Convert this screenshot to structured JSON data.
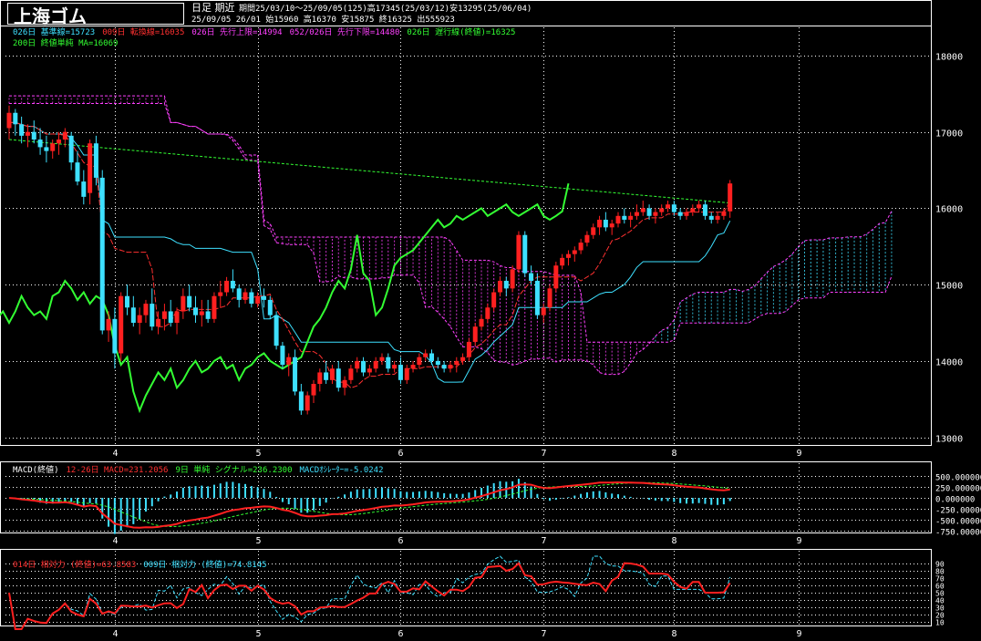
{
  "header": {
    "title": "上海ゴム",
    "period_label": "日足 期近",
    "period_info": "期間25/03/10〜25/09/05(125)高17345(25/03/12)安13295(25/06/04)",
    "last_bar": "25/09/05 26/01 始15960 高16370 安15875 終16325 出555923"
  },
  "legend_main": [
    {
      "text": "026日 基準線=15723",
      "color": "#3ee0ff"
    },
    {
      "text": "009日 転換線=16035",
      "color": "#ff3030"
    },
    {
      "text": "026日 先行上限=14994",
      "color": "#ff40ff"
    },
    {
      "text": "052/026日 先行下限=14480",
      "color": "#ff40ff"
    },
    {
      "text": "026日 遅行線(終値)=16325",
      "color": "#33ff33"
    }
  ],
  "legend_main2": [
    {
      "text": "200日 終値単純 MA=16069",
      "color": "#33ff33"
    }
  ],
  "legend_macd": [
    {
      "text": "MACD(終値)",
      "color": "#ffffff"
    },
    {
      "text": "12-26日 MACD=231.2056",
      "color": "#ff3030"
    },
    {
      "text": "9日 単純 シグナル=236.2300",
      "color": "#33ff33"
    },
    {
      "text": "MACDｵｼﾚｰﾀｰ=-5.0242",
      "color": "#3ee0ff"
    }
  ],
  "legend_rsi": [
    {
      "text": "014日 相対力 (終値)=63.8583",
      "color": "#ff3030"
    },
    {
      "text": "009日 相対力 (終値)=74.8145",
      "color": "#3ee0ff"
    }
  ],
  "chart_data": [
    {
      "type": "candlestick",
      "title": "上海ゴム",
      "x_tick_labels": [
        "4",
        "5",
        "6",
        "7",
        "8",
        "9"
      ],
      "y_ticks": [
        13000,
        14000,
        15000,
        16000,
        17000,
        18000
      ],
      "ylim": [
        12900,
        18250
      ],
      "grid": true,
      "ohlc": [
        [
          17050,
          17345,
          16900,
          17250
        ],
        [
          17250,
          17300,
          16950,
          17100
        ],
        [
          17100,
          17200,
          16850,
          16950
        ],
        [
          16950,
          17100,
          16800,
          17000
        ],
        [
          17000,
          17150,
          16850,
          16900
        ],
        [
          16900,
          17050,
          16700,
          16800
        ],
        [
          16800,
          16950,
          16600,
          16750
        ],
        [
          16750,
          16900,
          16650,
          16850
        ],
        [
          16850,
          17000,
          16700,
          16900
        ],
        [
          16900,
          17050,
          16800,
          17000
        ],
        [
          16950,
          17000,
          16500,
          16600
        ],
        [
          16600,
          16750,
          16300,
          16350
        ],
        [
          16350,
          16500,
          16050,
          16150
        ],
        [
          16200,
          16900,
          16050,
          16850
        ],
        [
          16850,
          16950,
          16300,
          16400
        ],
        [
          16400,
          16500,
          14350,
          14400
        ],
        [
          14400,
          14650,
          14250,
          14550
        ],
        [
          14550,
          14700,
          13900,
          14100
        ],
        [
          14100,
          14900,
          14000,
          14850
        ],
        [
          14850,
          15000,
          14600,
          14700
        ],
        [
          14700,
          14850,
          14450,
          14500
        ],
        [
          14500,
          14700,
          14350,
          14600
        ],
        [
          14600,
          14800,
          14500,
          14750
        ],
        [
          14750,
          14950,
          14400,
          14450
        ],
        [
          14450,
          14650,
          14350,
          14550
        ],
        [
          14550,
          14750,
          14400,
          14650
        ],
        [
          14650,
          14800,
          14450,
          14500
        ],
        [
          14500,
          14700,
          14350,
          14650
        ],
        [
          14650,
          14950,
          14550,
          14850
        ],
        [
          14850,
          15000,
          14650,
          14700
        ],
        [
          14700,
          14850,
          14500,
          14600
        ],
        [
          14600,
          14800,
          14450,
          14650
        ],
        [
          14650,
          14800,
          14500,
          14550
        ],
        [
          14550,
          14900,
          14500,
          14850
        ],
        [
          14850,
          15050,
          14700,
          14900
        ],
        [
          14900,
          15100,
          14850,
          15050
        ],
        [
          15050,
          15200,
          14900,
          14950
        ],
        [
          14950,
          15000,
          14700,
          14800
        ],
        [
          14800,
          14950,
          14750,
          14900
        ],
        [
          14900,
          14950,
          14700,
          14750
        ],
        [
          14750,
          14900,
          14700,
          14850
        ],
        [
          14850,
          14950,
          14700,
          14800
        ],
        [
          14800,
          14850,
          14550,
          14600
        ],
        [
          14600,
          14650,
          14150,
          14200
        ],
        [
          14200,
          14250,
          13900,
          13950
        ],
        [
          13950,
          14100,
          13800,
          14050
        ],
        [
          14050,
          14150,
          13550,
          13600
        ],
        [
          13600,
          13700,
          13295,
          13350
        ],
        [
          13350,
          13600,
          13300,
          13550
        ],
        [
          13550,
          13750,
          13450,
          13700
        ],
        [
          13700,
          13900,
          13600,
          13850
        ],
        [
          13850,
          14000,
          13700,
          13750
        ],
        [
          13750,
          13950,
          13700,
          13900
        ],
        [
          13900,
          14000,
          13600,
          13650
        ],
        [
          13650,
          13800,
          13550,
          13750
        ],
        [
          13750,
          13950,
          13700,
          13900
        ],
        [
          13900,
          14050,
          13850,
          14000
        ],
        [
          14000,
          14050,
          13800,
          13850
        ],
        [
          13850,
          13950,
          13800,
          13900
        ],
        [
          13900,
          14050,
          13850,
          14000
        ],
        [
          14000,
          14100,
          13950,
          14050
        ],
        [
          14050,
          14100,
          13850,
          13900
        ],
        [
          13900,
          14000,
          13850,
          13950
        ],
        [
          13950,
          14050,
          13700,
          13750
        ],
        [
          13750,
          13950,
          13700,
          13900
        ],
        [
          13900,
          14000,
          13850,
          13950
        ],
        [
          13950,
          14100,
          13900,
          14050
        ],
        [
          14050,
          14150,
          14000,
          14100
        ],
        [
          14100,
          14150,
          13950,
          14000
        ],
        [
          14000,
          14050,
          13900,
          13950
        ],
        [
          13950,
          14000,
          13850,
          13900
        ],
        [
          13900,
          14000,
          13850,
          13950
        ],
        [
          13950,
          14050,
          13850,
          14000
        ],
        [
          14000,
          14100,
          13950,
          14050
        ],
        [
          14050,
          14300,
          14000,
          14250
        ],
        [
          14250,
          14500,
          14200,
          14450
        ],
        [
          14450,
          14600,
          14400,
          14550
        ],
        [
          14550,
          14750,
          14500,
          14700
        ],
        [
          14700,
          14950,
          14650,
          14900
        ],
        [
          14900,
          15100,
          14850,
          15050
        ],
        [
          15050,
          15100,
          14850,
          14950
        ],
        [
          14950,
          15250,
          14900,
          15200
        ],
        [
          15200,
          15700,
          15150,
          15650
        ],
        [
          15650,
          15700,
          15100,
          15150
        ],
        [
          15150,
          15250,
          15000,
          15050
        ],
        [
          15050,
          15150,
          14550,
          14600
        ],
        [
          14600,
          14750,
          14500,
          14700
        ],
        [
          14700,
          15000,
          14650,
          14950
        ],
        [
          14950,
          15300,
          14900,
          15250
        ],
        [
          15250,
          15400,
          15200,
          15350
        ],
        [
          15350,
          15450,
          15250,
          15400
        ],
        [
          15400,
          15500,
          15300,
          15450
        ],
        [
          15450,
          15600,
          15400,
          15550
        ],
        [
          15550,
          15700,
          15500,
          15650
        ],
        [
          15650,
          15800,
          15600,
          15750
        ],
        [
          15750,
          15900,
          15650,
          15850
        ],
        [
          15850,
          15950,
          15700,
          15750
        ],
        [
          15750,
          15850,
          15650,
          15800
        ],
        [
          15800,
          15950,
          15750,
          15900
        ],
        [
          15900,
          16000,
          15800,
          15850
        ],
        [
          15850,
          15950,
          15750,
          15900
        ],
        [
          15900,
          16050,
          15850,
          15950
        ],
        [
          15950,
          16100,
          15900,
          16000
        ],
        [
          16000,
          16050,
          15850,
          15900
        ],
        [
          15900,
          16000,
          15800,
          15950
        ],
        [
          15950,
          16050,
          15900,
          16000
        ],
        [
          16000,
          16100,
          15950,
          16050
        ],
        [
          16050,
          16100,
          15900,
          15950
        ],
        [
          15950,
          16000,
          15850,
          15900
        ],
        [
          15900,
          16000,
          15850,
          15950
        ],
        [
          15950,
          16050,
          15900,
          16000
        ],
        [
          16000,
          16100,
          15950,
          16050
        ],
        [
          16050,
          16100,
          15850,
          15900
        ],
        [
          15900,
          15950,
          15800,
          15850
        ],
        [
          15850,
          15950,
          15800,
          15900
        ],
        [
          15900,
          16000,
          15850,
          15960
        ],
        [
          15960,
          16370,
          15875,
          16325
        ]
      ],
      "tenkan_end": 16035,
      "kijun_end": 15723,
      "senkou_a_end": 14994,
      "senkou_b_end": 14480,
      "chikou_end": 16325,
      "ma200_end": 16069
    },
    {
      "type": "macd",
      "y_ticks": [
        500,
        250,
        0,
        -250,
        -500,
        -750
      ],
      "y_tick_labels": [
        "500.000000",
        "250.000000",
        "0.000000",
        "-250.00000",
        "-500.00000",
        "-750.00000"
      ],
      "ylim": [
        -800,
        550
      ],
      "macd_last": 231.2056,
      "signal_last": 236.23,
      "oscillator_last": -5.0242
    },
    {
      "type": "line",
      "y_ticks": [
        90,
        80,
        70,
        60,
        50,
        40,
        30,
        20,
        10
      ],
      "y_tick_labels": [
        "90",
        "80",
        "70",
        "60",
        "50",
        "40",
        "30",
        "20",
        "10"
      ],
      "ylim": [
        5,
        95
      ],
      "rsi14_last": 63.8583,
      "rsi9_last": 74.8145
    }
  ]
}
